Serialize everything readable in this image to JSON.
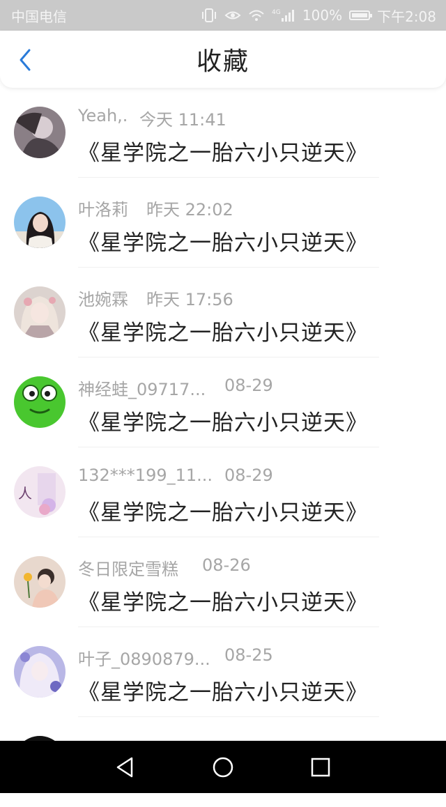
{
  "status_bar": {
    "carrier": "中国电信",
    "battery": "100%",
    "network": "4G",
    "time": "下午2:08"
  },
  "header": {
    "title": "收藏",
    "back_icon": "chevron-left-icon"
  },
  "accent_color": "#2a7bd9",
  "items": [
    {
      "user": "Yeah,.",
      "time": "今天 11:41",
      "title": "《星学院之一胎六小只逆天》"
    },
    {
      "user": "叶洛莉",
      "time": "昨天 22:02",
      "title": "《星学院之一胎六小只逆天》"
    },
    {
      "user": "池婉霖",
      "time": "昨天 17:56",
      "title": "《星学院之一胎六小只逆天》"
    },
    {
      "user": "神经蛙_09717...",
      "time": "08-29",
      "title": "《星学院之一胎六小只逆天》"
    },
    {
      "user": "132***199_11...",
      "time": "08-29",
      "title": "《星学院之一胎六小只逆天》"
    },
    {
      "user": "冬日限定雪糕",
      "time": "08-26",
      "title": "《星学院之一胎六小只逆天》"
    },
    {
      "user": "叶子_0890879...",
      "time": "08-25",
      "title": "《星学院之一胎六小只逆天》"
    }
  ],
  "nav_bar": {
    "back": "triangle-back-icon",
    "home": "circle-home-icon",
    "recent": "square-recent-icon"
  }
}
